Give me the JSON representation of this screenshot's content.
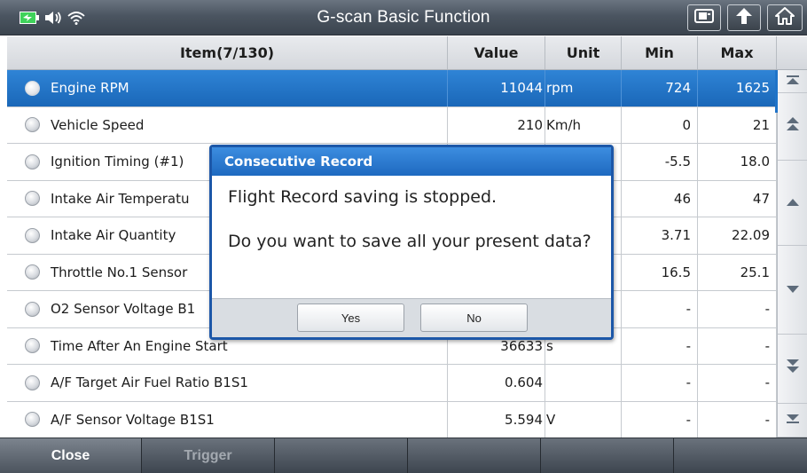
{
  "window": {
    "title": "G-scan Basic Function",
    "status_icons": [
      "battery-charging-icon",
      "speaker-icon",
      "wifi-icon"
    ],
    "toolbar_icons": [
      "screen-capture-icon",
      "back-icon",
      "home-icon"
    ]
  },
  "table": {
    "headers": {
      "item": "Item(7/130)",
      "value": "Value",
      "unit": "Unit",
      "min": "Min",
      "max": "Max"
    },
    "rows": [
      {
        "item": "Engine RPM",
        "value": "11044",
        "unit": "rpm",
        "min": "724",
        "max": "1625",
        "selected": true
      },
      {
        "item": "Vehicle Speed",
        "value": "210",
        "unit": "Km/h",
        "min": "0",
        "max": "21"
      },
      {
        "item": "Ignition Timing (#1)",
        "value": "",
        "unit": "",
        "min": "-5.5",
        "max": "18.0"
      },
      {
        "item": "Intake Air Temperatu",
        "value": "",
        "unit": "",
        "min": "46",
        "max": "47"
      },
      {
        "item": "Intake Air Quantity",
        "value": "",
        "unit": "",
        "min": "3.71",
        "max": "22.09"
      },
      {
        "item": "Throttle No.1 Sensor",
        "value": "",
        "unit": "",
        "min": "16.5",
        "max": "25.1"
      },
      {
        "item": "O2 Sensor Voltage B1",
        "value": "",
        "unit": "",
        "min": "-",
        "max": "-"
      },
      {
        "item": "Time After An Engine Start",
        "value": "36633",
        "unit": "s",
        "min": "-",
        "max": "-"
      },
      {
        "item": "A/F Target Air Fuel Ratio B1S1",
        "value": "0.604",
        "unit": "",
        "min": "-",
        "max": "-"
      },
      {
        "item": "A/F Sensor Voltage B1S1",
        "value": "5.594",
        "unit": "V",
        "min": "-",
        "max": "-"
      }
    ]
  },
  "scrollbar": {
    "buttons": [
      "scroll-top-icon",
      "page-up-icon",
      "line-up-icon",
      "line-down-icon",
      "page-down-icon",
      "scroll-bottom-icon"
    ]
  },
  "bottom_bar": {
    "close_label": "Close",
    "trigger_label": "Trigger"
  },
  "dialog": {
    "title": "Consecutive Record",
    "message_line1": "Flight Record saving is stopped.",
    "message_line2": "Do you want to save all your present data?",
    "yes_label": "Yes",
    "no_label": "No"
  },
  "colors": {
    "accent": "#1f73c8",
    "selected_row": "#2f84d6",
    "dialog_border": "#1c57a8"
  }
}
